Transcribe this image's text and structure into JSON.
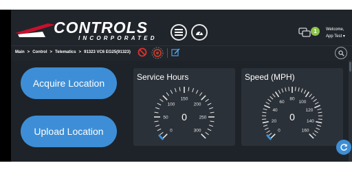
{
  "brand": {
    "name": "CONTROLS",
    "tagline": "INCORPORATED"
  },
  "header": {
    "message_badge": "1",
    "welcome_line1": "Welcome,",
    "welcome_line2": "App Test ▾"
  },
  "breadcrumb": [
    "Main",
    "Control",
    "Telematics",
    "91323 VC6 EG25(91323)"
  ],
  "breadcrumb_separator": ">",
  "actions": {
    "acquire": "Acquire Location",
    "upload": "Upload Location"
  },
  "gauges": [
    {
      "title": "Service Hours",
      "value": "0",
      "max": 300,
      "ticks": [
        "0",
        "50",
        "100",
        "150",
        "200",
        "250",
        "300"
      ]
    },
    {
      "title": "Speed (MPH)",
      "value": "0",
      "max": 160,
      "ticks": [
        "0",
        "20",
        "40",
        "60",
        "80",
        "100",
        "120",
        "140",
        "160"
      ]
    }
  ],
  "colors": {
    "background": "#1e2329",
    "card": "#2b3138",
    "accent": "#3d8ed6",
    "badge": "#8bc34a",
    "logo_red": "#c8102e"
  }
}
